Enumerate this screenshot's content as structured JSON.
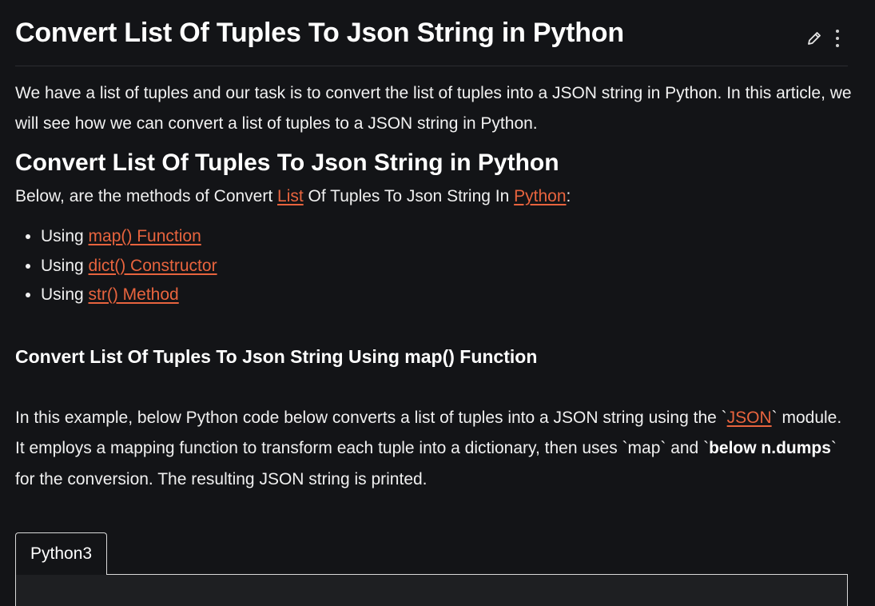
{
  "header": {
    "title": "Convert List Of Tuples To Json String in Python",
    "edit_icon": "pencil-icon",
    "more_icon": "kebab-menu-icon"
  },
  "article": {
    "intro": "We have a list of tuples and our task is to convert the list of tuples into a JSON string in Python. In this article, we will see how we can convert a list of tuples to a JSON string in Python.",
    "section_title": "Convert List Of Tuples To Json String in Python",
    "methods_intro": {
      "before": "Below, are the methods of Convert ",
      "link_list": "List",
      "middle": " Of Tuples To Json String In ",
      "link_python": "Python",
      "after": ":"
    },
    "methods": [
      {
        "prefix": "Using ",
        "link": "map() Function"
      },
      {
        "prefix": "Using ",
        "link": "dict() Constructor"
      },
      {
        "prefix": "Using ",
        "link": "str() Method"
      }
    ],
    "subsection_title": "Convert List Of Tuples To Json String Using map() Function",
    "example": {
      "part1": "In this example, below Python code below converts a list of tuples into a JSON string using the `",
      "link_json": "JSON",
      "part2": "` module. It employs a mapping function to transform each tuple into a dictionary, then uses `map` and `",
      "bold": "below n.dumps",
      "part3": "` for the conversion. The resulting JSON string is printed."
    },
    "code_tab": "Python3"
  },
  "colors": {
    "background": "#131417",
    "link": "#e8643e",
    "text": "#f2f2f2"
  }
}
